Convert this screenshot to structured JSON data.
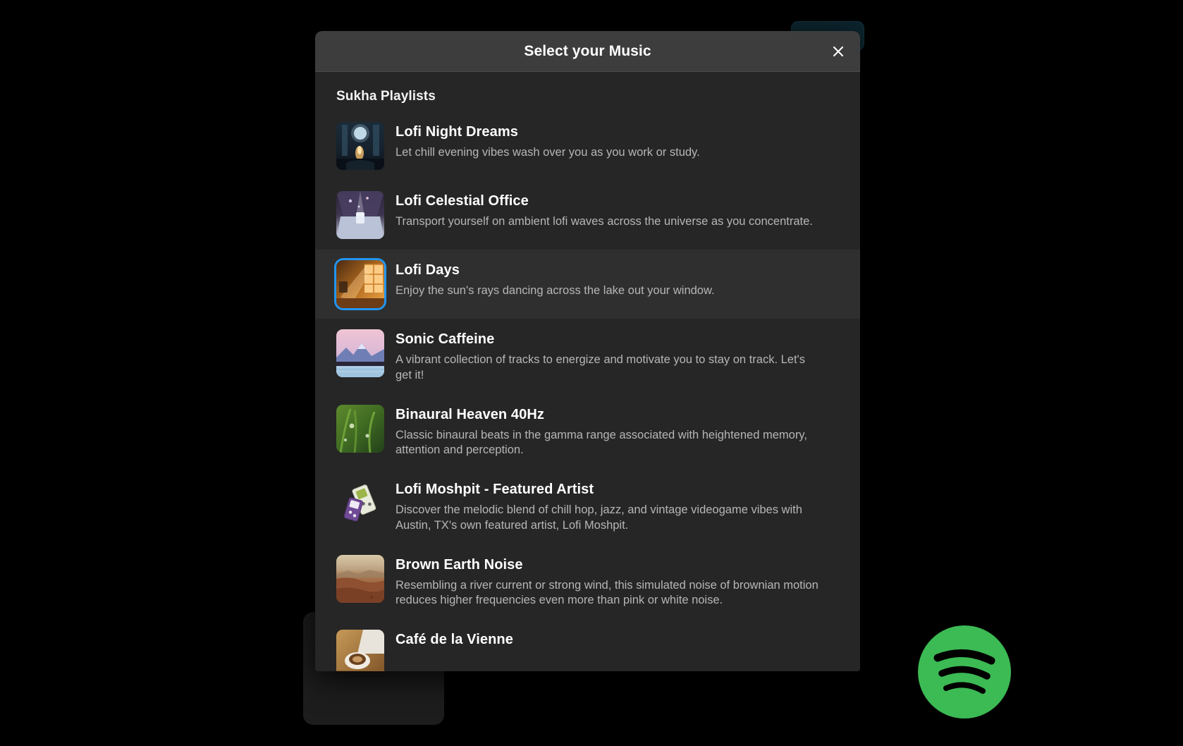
{
  "background": {
    "page_color": "#000000",
    "panel_color": "#0d2630"
  },
  "modal": {
    "title": "Select your Music",
    "close_label": "×",
    "header_color": "#3d3d3d",
    "body_color": "#262626",
    "selection_accent": "#2196f3"
  },
  "section": {
    "title": "Sukha Playlists"
  },
  "playlists": [
    {
      "title": "Lofi Night Dreams",
      "description": "Let chill evening vibes wash over you as you work or study.",
      "selected": false,
      "thumb": "moonlit-window-candle"
    },
    {
      "title": "Lofi Celestial Office",
      "description": "Transport yourself on ambient lofi waves across the universe as you concentrate.",
      "selected": false,
      "thumb": "celestial-office"
    },
    {
      "title": "Lofi Days",
      "description": "Enjoy the sun's rays dancing across the lake out your window.",
      "selected": true,
      "thumb": "sunlit-room"
    },
    {
      "title": "Sonic Caffeine",
      "description": "A vibrant collection of tracks to energize and motivate you to stay on track. Let's get it!",
      "selected": false,
      "thumb": "pink-mountain-lake"
    },
    {
      "title": "Binaural Heaven 40Hz",
      "description": "Classic binaural beats in the gamma range associated with heightened memory, attention and perception.",
      "selected": false,
      "thumb": "green-dewy-grass"
    },
    {
      "title": "Lofi Moshpit - Featured Artist",
      "description": "Discover the melodic blend of chill hop, jazz, and vintage videogame vibes with Austin, TX's own featured artist, Lofi Moshpit.",
      "selected": false,
      "thumb": "handheld-consoles"
    },
    {
      "title": "Brown Earth Noise",
      "description": "Resembling a river current or strong wind, this simulated noise of brownian motion reduces higher frequencies even more than pink or white noise.",
      "selected": false,
      "thumb": "brown-desert-landscape"
    },
    {
      "title": "Café de la Vienne",
      "description": "",
      "selected": false,
      "thumb": "coffee-cup-table"
    }
  ],
  "spotify": {
    "label": "Spotify",
    "brand_color": "#3cba54"
  }
}
